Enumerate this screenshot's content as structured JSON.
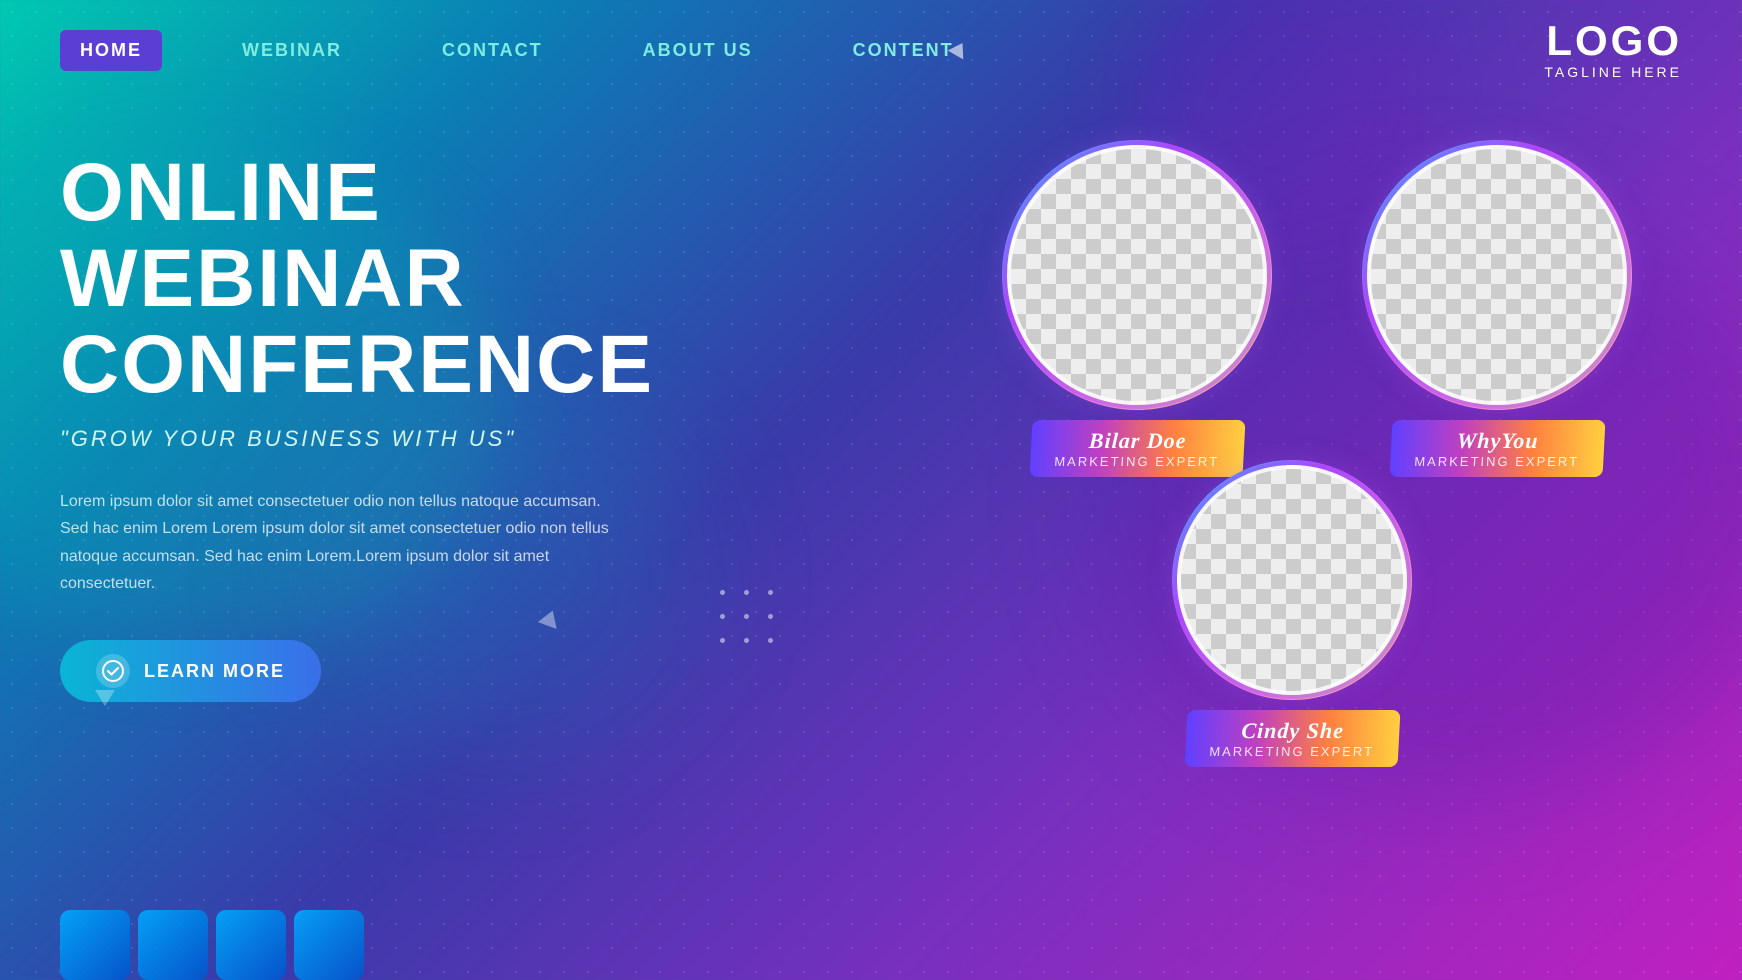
{
  "nav": {
    "items": [
      {
        "label": "HOME",
        "active": true
      },
      {
        "label": "WEBINAR",
        "active": false
      },
      {
        "label": "CONTACT",
        "active": false
      },
      {
        "label": "ABOUT US",
        "active": false
      },
      {
        "label": "CONTENT",
        "active": false
      }
    ]
  },
  "logo": {
    "title": "LOGO",
    "tagline": "TAGLINE HERE"
  },
  "hero": {
    "title": "ONLINE WEBINAR\nCONFERENCE",
    "subtitle": "\"GROW YOUR BUSINESS WITH US\"",
    "description": "Lorem ipsum dolor sit amet consectetuer odio non tellus natoque accumsan. Sed hac enim Lorem Lorem ipsum dolor sit amet consectetuer odio non tellus natoque accumsan. Sed hac enim Lorem.Lorem ipsum dolor sit amet consectetuer.",
    "cta_label": "LEARN MORE"
  },
  "speakers": [
    {
      "name": "Bilar Doe",
      "role": "Marketing Expert",
      "size": "large"
    },
    {
      "name": "WhyYou",
      "role": "Marketing Expert",
      "size": "large"
    },
    {
      "name": "Cindy She",
      "role": "Marketing Expert",
      "size": "medium"
    }
  ]
}
